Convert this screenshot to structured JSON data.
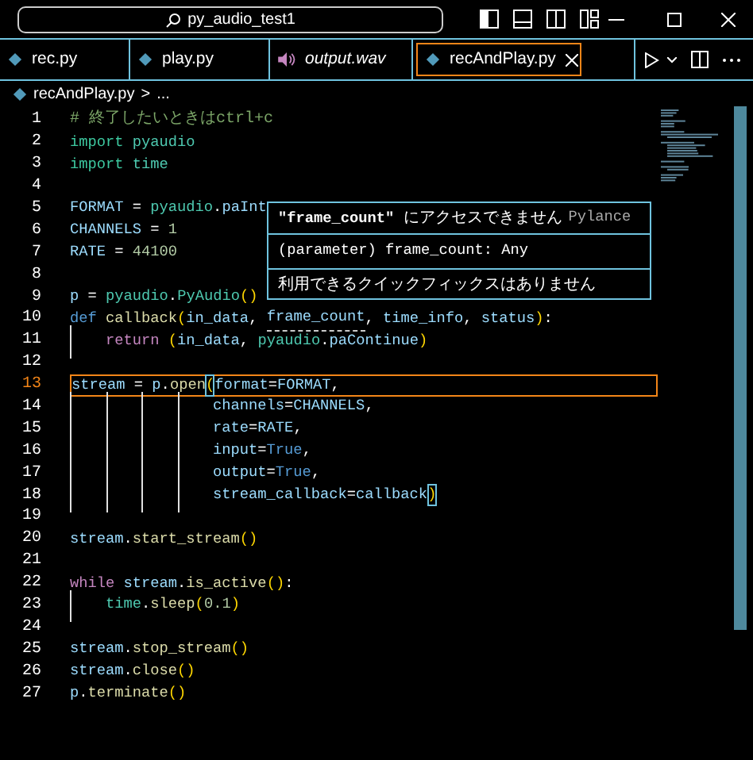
{
  "title_bar": {
    "search_text": "py_audio_test1"
  },
  "tabs": [
    {
      "label": "rec.py",
      "kind": "python",
      "selected": false,
      "preview": false
    },
    {
      "label": "play.py",
      "kind": "python",
      "selected": false,
      "preview": false
    },
    {
      "label": "output.wav",
      "kind": "audio",
      "selected": false,
      "preview": true
    },
    {
      "label": "recAndPlay.py",
      "kind": "python",
      "selected": true,
      "preview": false
    }
  ],
  "breadcrumb": {
    "file": "recAndPlay.py",
    "separator": ">",
    "rest": "..."
  },
  "editor": {
    "lines": [
      {
        "number": "1",
        "current": false,
        "tokens": [
          {
            "kind": "comment",
            "text": "# 終了したいときはctrl+c"
          }
        ]
      },
      {
        "number": "2",
        "current": false,
        "tokens": [
          {
            "kind": "keyword",
            "text": "import"
          },
          {
            "kind": "module",
            "text": " pyaudio"
          }
        ]
      },
      {
        "number": "3",
        "current": false,
        "tokens": [
          {
            "kind": "keyword",
            "text": "import"
          },
          {
            "kind": "module",
            "text": " time"
          }
        ]
      },
      {
        "number": "4",
        "current": false
      },
      {
        "number": "5",
        "current": false,
        "tokens": [
          {
            "kind": "variable",
            "text": "FORMAT"
          },
          {
            "kind": "plain",
            "text": " = "
          },
          {
            "kind": "module",
            "text": "pyaudio"
          },
          {
            "kind": "plain",
            "text": "."
          },
          {
            "kind": "variable",
            "text": "paInt"
          }
        ]
      },
      {
        "number": "6",
        "current": false,
        "tokens": [
          {
            "kind": "variable",
            "text": "CHANNELS"
          },
          {
            "kind": "plain",
            "text": " = "
          },
          {
            "kind": "number",
            "text": "1"
          }
        ]
      },
      {
        "number": "7",
        "current": false,
        "tokens": [
          {
            "kind": "variable",
            "text": "RATE"
          },
          {
            "kind": "plain",
            "text": " = "
          },
          {
            "kind": "number",
            "text": "44100"
          }
        ]
      },
      {
        "number": "8",
        "current": false
      },
      {
        "number": "9",
        "current": false,
        "tokens": [
          {
            "kind": "variable",
            "text": "p"
          },
          {
            "kind": "plain",
            "text": " = "
          },
          {
            "kind": "module",
            "text": "pyaudio"
          },
          {
            "kind": "plain",
            "text": "."
          },
          {
            "kind": "class",
            "text": "PyAudio"
          },
          {
            "kind": "paren",
            "text": "()"
          }
        ]
      },
      {
        "number": "10",
        "current": false,
        "tokens": [
          {
            "kind": "storage",
            "text": "def"
          },
          {
            "kind": "function",
            "text": " callback"
          },
          {
            "kind": "paren",
            "text": "("
          },
          {
            "kind": "variable",
            "text": "in_data"
          },
          {
            "kind": "plain",
            "text": ", "
          },
          {
            "kind": "unused",
            "text": "frame_count"
          },
          {
            "kind": "plain",
            "text": ", "
          },
          {
            "kind": "variable",
            "text": "time_info"
          },
          {
            "kind": "plain",
            "text": ", "
          },
          {
            "kind": "variable",
            "text": "status"
          },
          {
            "kind": "paren",
            "text": ")"
          },
          {
            "kind": "plain",
            "text": ":"
          }
        ]
      },
      {
        "number": "11",
        "current": false,
        "tokens": [
          {
            "kind": "control",
            "text": "    return"
          },
          {
            "kind": "paren",
            "text": " ("
          },
          {
            "kind": "variable",
            "text": "in_data"
          },
          {
            "kind": "plain",
            "text": ", "
          },
          {
            "kind": "module",
            "text": "pyaudio"
          },
          {
            "kind": "plain",
            "text": "."
          },
          {
            "kind": "variable",
            "text": "paContinue"
          },
          {
            "kind": "paren",
            "text": ")"
          }
        ]
      },
      {
        "number": "12",
        "current": false
      },
      {
        "number": "13",
        "current": true,
        "tokens": [
          {
            "kind": "variable",
            "text": "stream"
          },
          {
            "kind": "plain",
            "text": " = "
          },
          {
            "kind": "variable",
            "text": "p"
          },
          {
            "kind": "plain",
            "text": "."
          },
          {
            "kind": "function",
            "text": "open"
          },
          {
            "kind": "bracket_match",
            "text": "("
          },
          {
            "kind": "variable",
            "text": "format"
          },
          {
            "kind": "plain",
            "text": "="
          },
          {
            "kind": "variable",
            "text": "FORMAT"
          },
          {
            "kind": "plain",
            "text": ","
          }
        ]
      },
      {
        "number": "14",
        "current": false,
        "tokens": [
          {
            "kind": "variable",
            "text": "                channels"
          },
          {
            "kind": "plain",
            "text": "="
          },
          {
            "kind": "variable",
            "text": "CHANNELS"
          },
          {
            "kind": "plain",
            "text": ","
          }
        ]
      },
      {
        "number": "15",
        "current": false,
        "tokens": [
          {
            "kind": "variable",
            "text": "                rate"
          },
          {
            "kind": "plain",
            "text": "="
          },
          {
            "kind": "variable",
            "text": "RATE"
          },
          {
            "kind": "plain",
            "text": ","
          }
        ]
      },
      {
        "number": "16",
        "current": false,
        "tokens": [
          {
            "kind": "variable",
            "text": "                input"
          },
          {
            "kind": "plain",
            "text": "="
          },
          {
            "kind": "constant",
            "text": "True"
          },
          {
            "kind": "plain",
            "text": ","
          }
        ]
      },
      {
        "number": "17",
        "current": false,
        "tokens": [
          {
            "kind": "variable",
            "text": "                output"
          },
          {
            "kind": "plain",
            "text": "="
          },
          {
            "kind": "constant",
            "text": "True"
          },
          {
            "kind": "plain",
            "text": ","
          }
        ]
      },
      {
        "number": "18",
        "current": false,
        "tokens": [
          {
            "kind": "variable",
            "text": "                stream_callback"
          },
          {
            "kind": "plain",
            "text": "="
          },
          {
            "kind": "variable",
            "text": "callback"
          },
          {
            "kind": "bracket_match",
            "text": ")"
          }
        ]
      },
      {
        "number": "19",
        "current": false
      },
      {
        "number": "20",
        "current": false,
        "tokens": [
          {
            "kind": "variable",
            "text": "stream"
          },
          {
            "kind": "plain",
            "text": "."
          },
          {
            "kind": "function",
            "text": "start_stream"
          },
          {
            "kind": "paren",
            "text": "()"
          }
        ]
      },
      {
        "number": "21",
        "current": false
      },
      {
        "number": "22",
        "current": false,
        "tokens": [
          {
            "kind": "control",
            "text": "while"
          },
          {
            "kind": "variable",
            "text": " stream"
          },
          {
            "kind": "plain",
            "text": "."
          },
          {
            "kind": "function",
            "text": "is_active"
          },
          {
            "kind": "paren",
            "text": "()"
          },
          {
            "kind": "plain",
            "text": ":"
          }
        ]
      },
      {
        "number": "23",
        "current": false,
        "tokens": [
          {
            "kind": "module",
            "text": "    time"
          },
          {
            "kind": "plain",
            "text": "."
          },
          {
            "kind": "function",
            "text": "sleep"
          },
          {
            "kind": "paren",
            "text": "("
          },
          {
            "kind": "number",
            "text": "0.1"
          },
          {
            "kind": "paren",
            "text": ")"
          }
        ]
      },
      {
        "number": "24",
        "current": false
      },
      {
        "number": "25",
        "current": false,
        "tokens": [
          {
            "kind": "variable",
            "text": "stream"
          },
          {
            "kind": "plain",
            "text": "."
          },
          {
            "kind": "function",
            "text": "stop_stream"
          },
          {
            "kind": "paren",
            "text": "()"
          }
        ]
      },
      {
        "number": "26",
        "current": false,
        "tokens": [
          {
            "kind": "variable",
            "text": "stream"
          },
          {
            "kind": "plain",
            "text": "."
          },
          {
            "kind": "function",
            "text": "close"
          },
          {
            "kind": "paren",
            "text": "()"
          }
        ]
      },
      {
        "number": "27",
        "current": false,
        "tokens": [
          {
            "kind": "variable",
            "text": "p"
          },
          {
            "kind": "plain",
            "text": "."
          },
          {
            "kind": "function",
            "text": "terminate"
          },
          {
            "kind": "paren",
            "text": "()"
          }
        ]
      }
    ]
  },
  "hover": {
    "message_code": "\"frame_count\"",
    "message": "にアクセスできません",
    "source": "Pylance",
    "signature": "(parameter) frame_count: Any",
    "footer": "利用できるクイックフィックスはありません"
  }
}
